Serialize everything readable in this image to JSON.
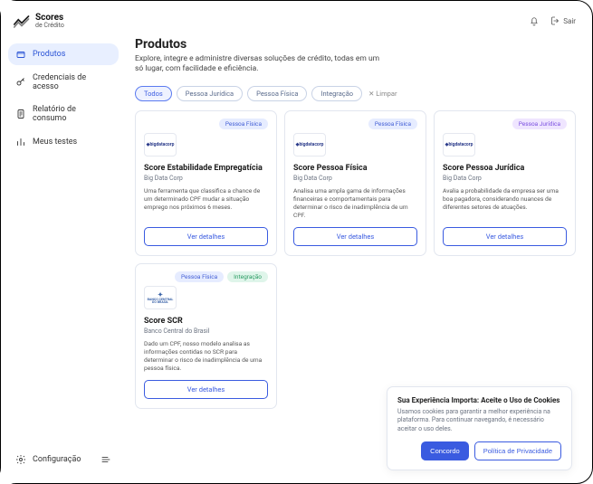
{
  "brand": {
    "title": "Scores",
    "subtitle": "de Crédito"
  },
  "topbar": {
    "exit_label": "Sair"
  },
  "sidebar": {
    "items": [
      {
        "label": "Produtos"
      },
      {
        "label": "Credenciais de acesso"
      },
      {
        "label": "Relatório de consumo"
      },
      {
        "label": "Meus testes"
      }
    ],
    "settings_label": "Configuração"
  },
  "page": {
    "title": "Produtos",
    "subtitle": "Explore, integre e administre diversas soluções de crédito, todas em um só lugar, com facilidade e eficiência."
  },
  "filters": {
    "chips": [
      "Todos",
      "Pessoa Jurídica",
      "Pessoa Física",
      "Integração"
    ],
    "clear_label": "Limpar"
  },
  "tags": {
    "pf": "Pessoa Física",
    "pj": "Pessoa Jurídica",
    "int": "Integração"
  },
  "providers": {
    "bigdatacorp": "bigdatacorp",
    "bc_lines": [
      "BANCO CENTRAL",
      "DO BRASIL"
    ]
  },
  "cards": [
    {
      "title": "Score Estabilidade Empregatícia",
      "provider": "Big Data Corp",
      "desc": "Uma ferramenta que classifica a chance de um determinado CPF mudar a situação emprego nos próximos 6 meses.",
      "cta": "Ver detalhes"
    },
    {
      "title": "Score Pessoa Física",
      "provider": "Big Data Corp",
      "desc": "Analisa uma ampla gama de informações financeiras e comportamentais para determinar o risco de inadimplência de um CPF.",
      "cta": "Ver detalhes"
    },
    {
      "title": "Score Pessoa Jurídica",
      "provider": "Big Data Corp",
      "desc": "Avalia a probabilidade da empresa ser uma boa pagadora, considerando nuances de diferentes setores de atuações.",
      "cta": "Ver detalhes"
    },
    {
      "title": "Score SCR",
      "provider": "Banco Central do Brasil",
      "desc": "Dado um CPF, nosso modelo analisa as informações contidas no SCR para determinar o risco de inadimplência de uma pessoa física.",
      "cta": "Ver detalhes"
    }
  ],
  "cookie": {
    "title": "Sua Experiência Importa: Aceite o Uso de Cookies",
    "body": "Usamos cookies para garantir a melhor experiência na plataforma. Para continuar navegando, é necessário aceitar o uso deles.",
    "accept": "Concordo",
    "policy": "Política de Privacidade"
  }
}
